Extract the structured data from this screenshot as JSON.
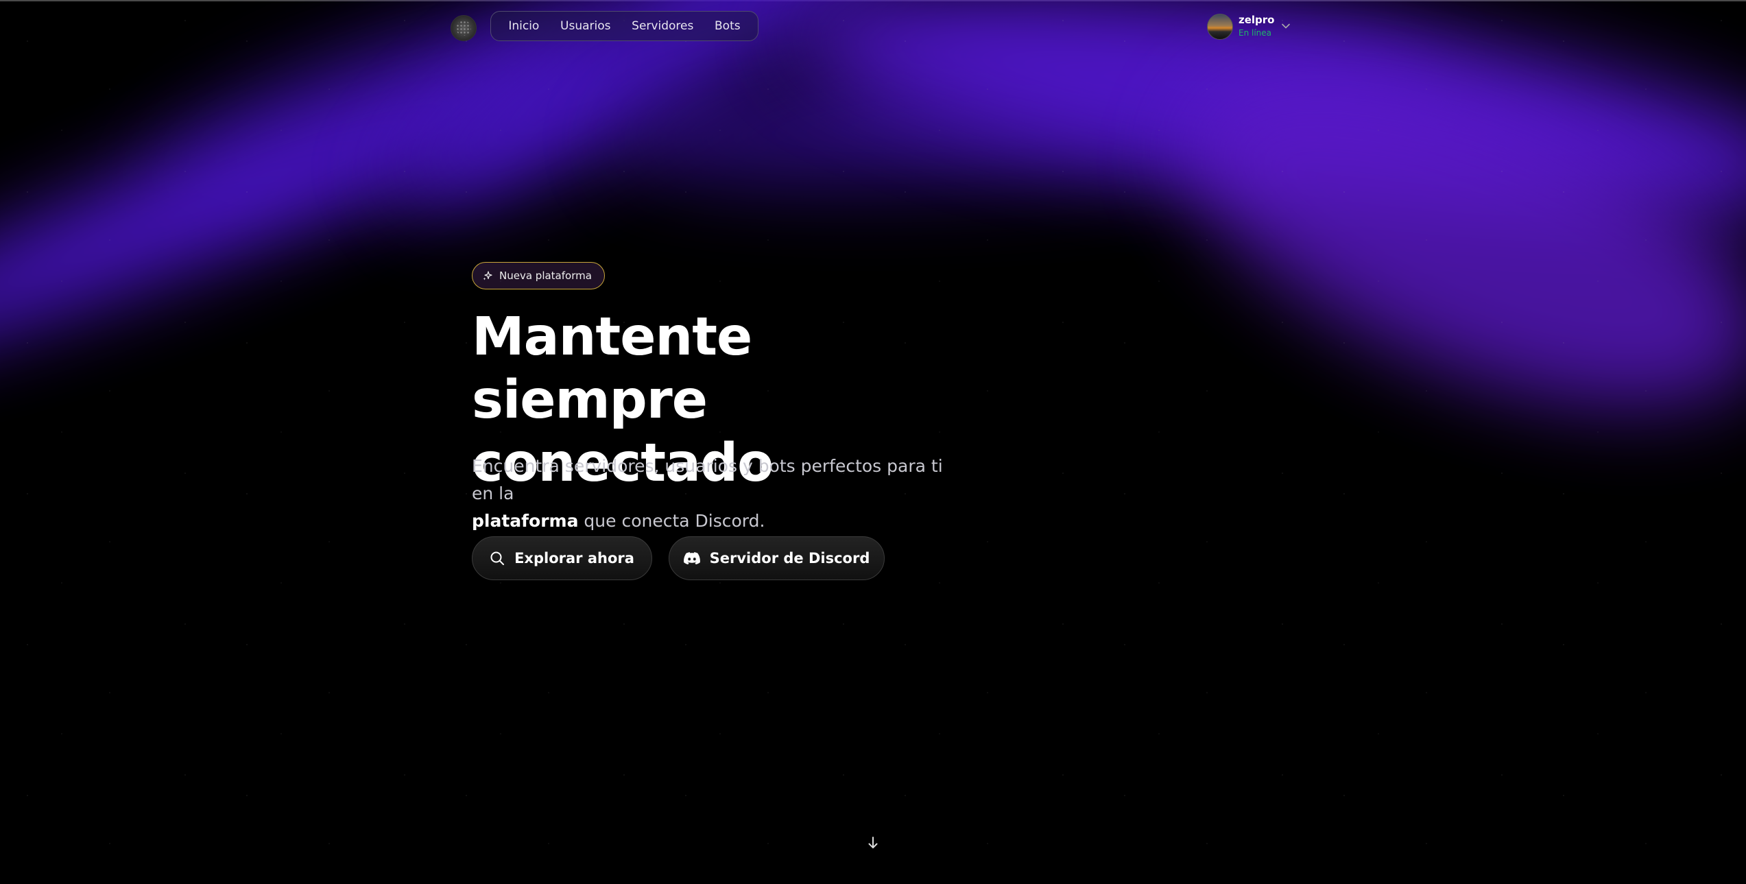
{
  "nav": {
    "items": [
      {
        "label": "Inicio"
      },
      {
        "label": "Usuarios"
      },
      {
        "label": "Servidores"
      },
      {
        "label": "Bots"
      }
    ]
  },
  "user": {
    "name": "zelpro",
    "status": "En línea",
    "status_color": "#1fb36a"
  },
  "hero": {
    "badge": "Nueva plataforma",
    "headline_line1": "Mantente siempre",
    "headline_line2": "conectado",
    "subtitle_part1": "Encuentra servidores, usuarios y bots perfectos para ti en la",
    "subtitle_highlight": "plataforma",
    "subtitle_part2": "que conecta Discord.",
    "explore_label": "Explorar ahora",
    "discord_label": "Servidor de Discord"
  },
  "icons": {
    "logo": "logo-icon",
    "badge": "sparkles-icon",
    "explore": "search-icon",
    "discord": "discord-icon",
    "user_menu": "chevron-down-icon",
    "scroll": "arrow-down-icon"
  },
  "colors": {
    "accent": "#5a19c6",
    "badge_border": "#c9a63a",
    "background": "#000000"
  }
}
